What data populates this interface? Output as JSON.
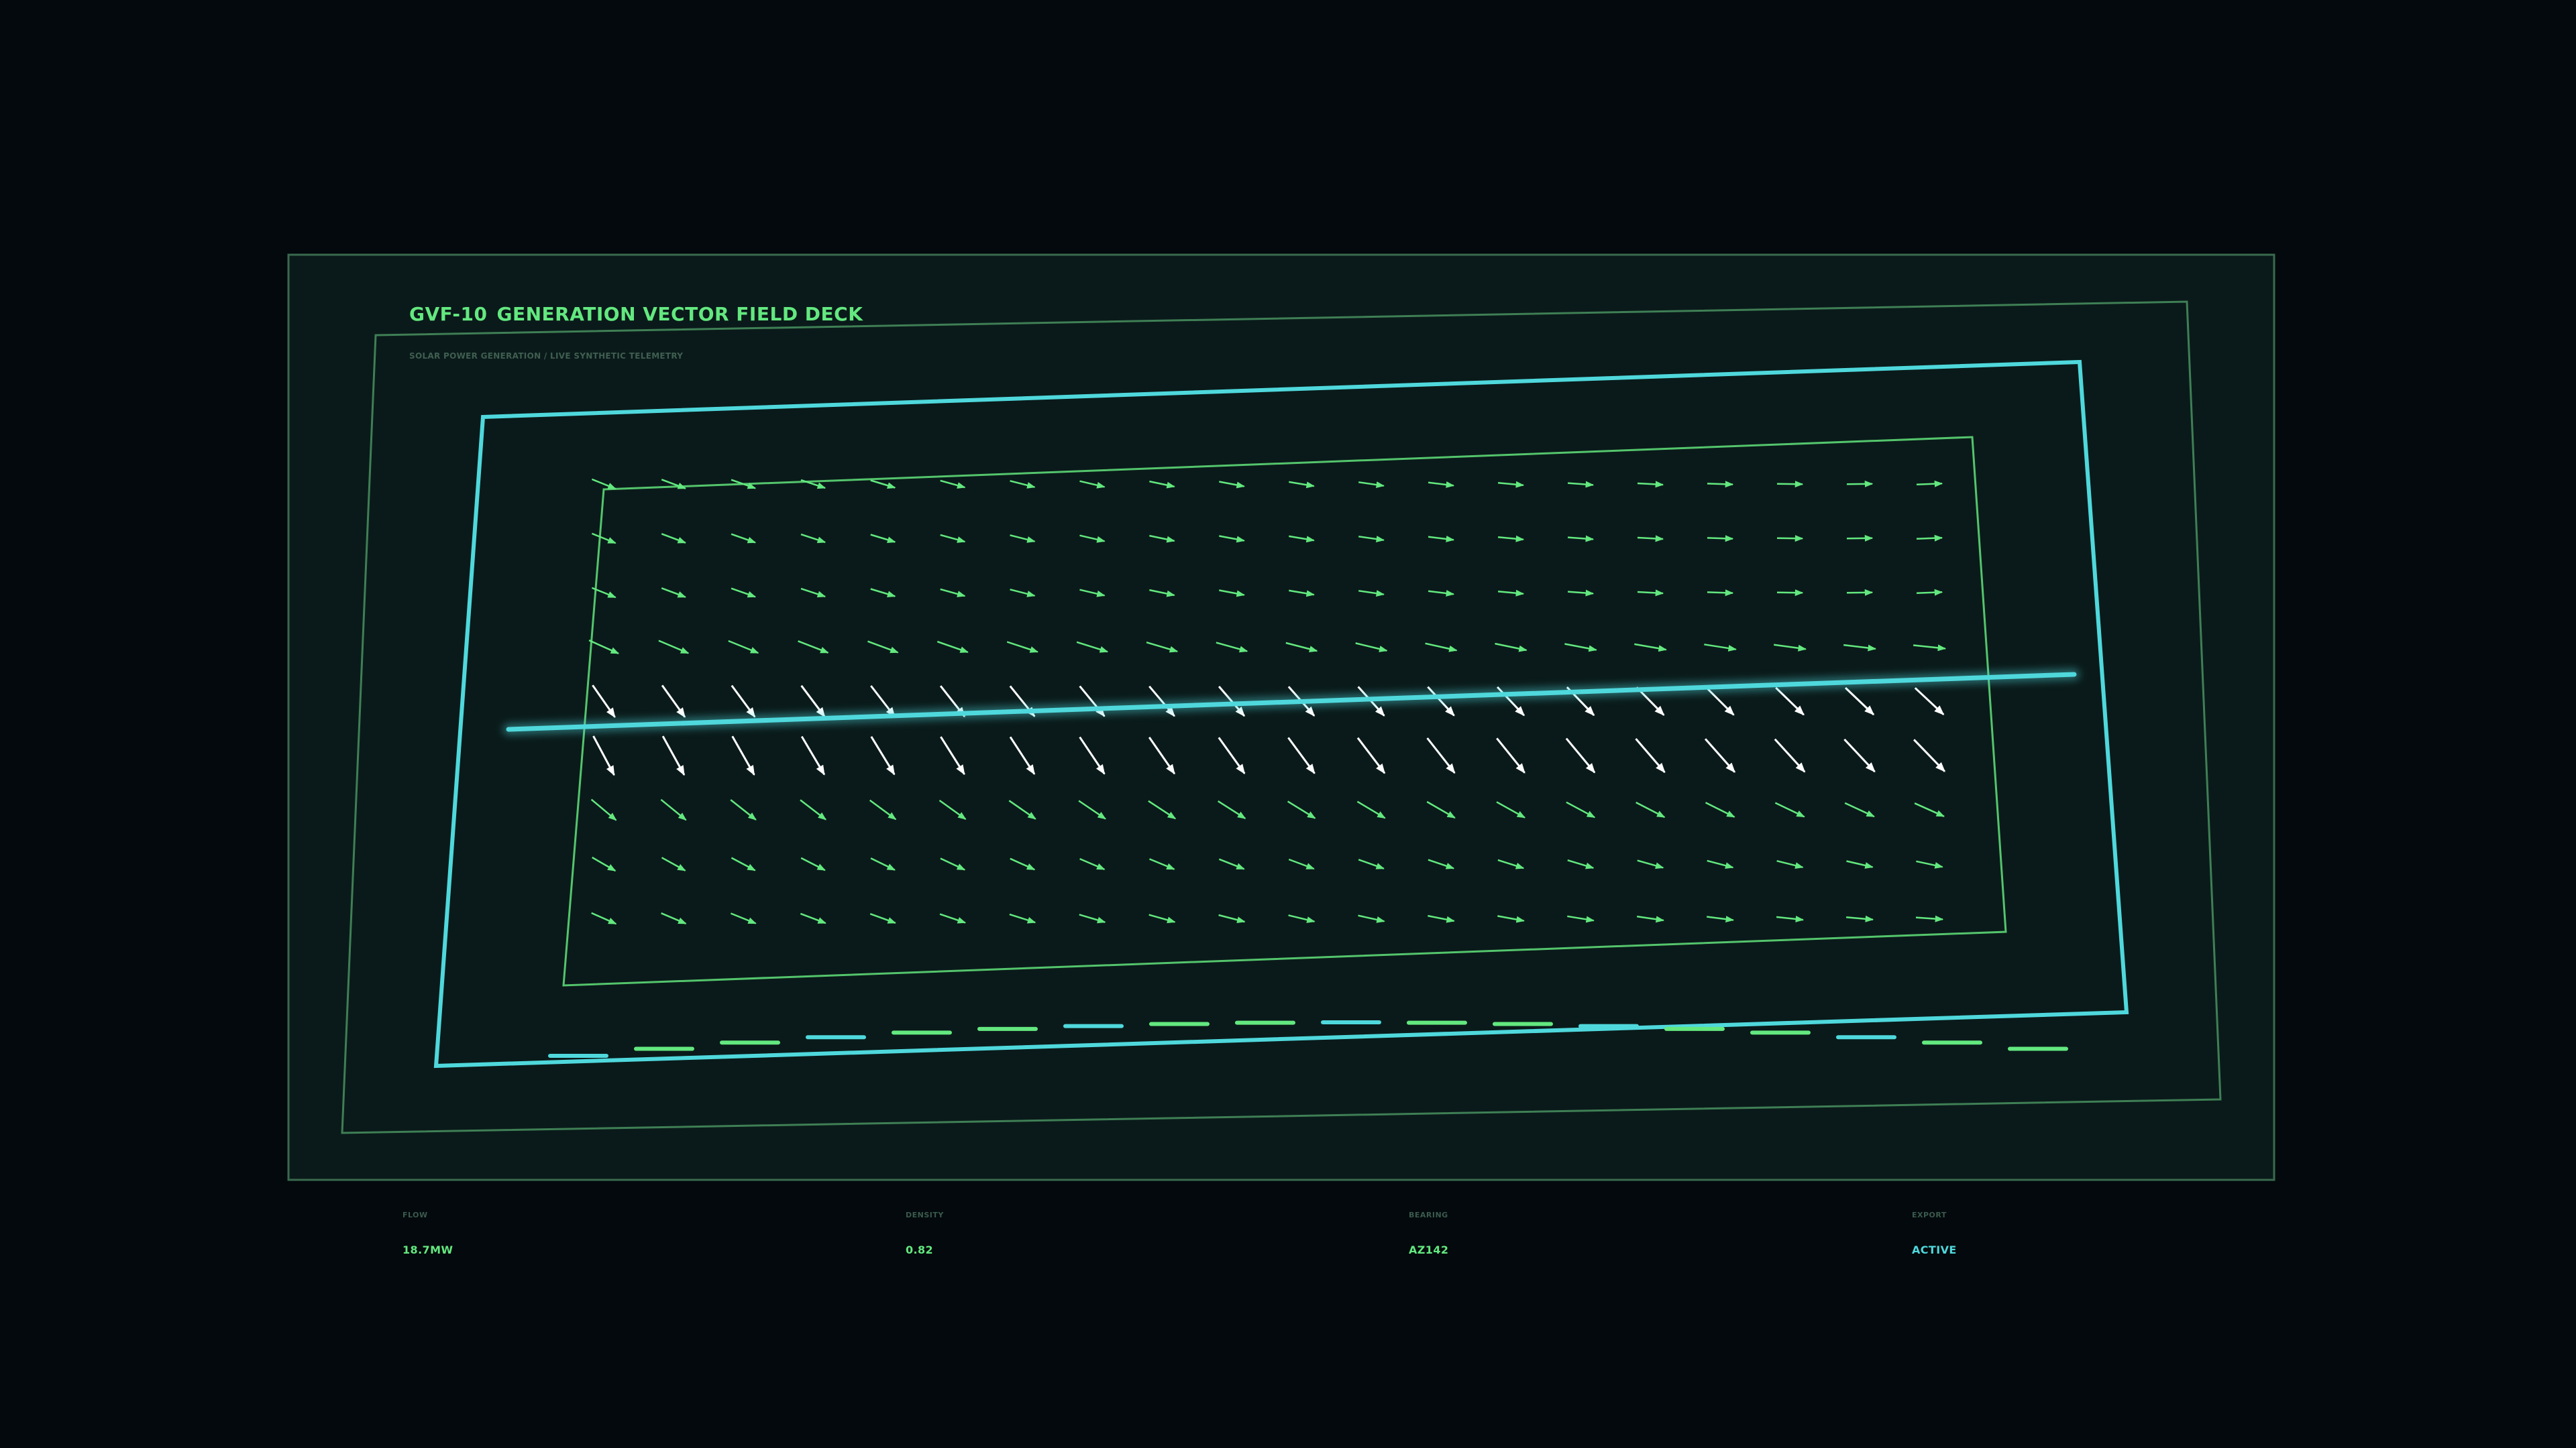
{
  "header": {
    "code": "GVF-10",
    "title": "GENERATION VECTOR FIELD DECK",
    "subtitle": "SOLAR POWER GENERATION / LIVE SYNTHETIC TELEMETRY"
  },
  "metrics": {
    "flow": {
      "label": "FLOW",
      "value": "18.7MW"
    },
    "density": {
      "label": "DENSITY",
      "value": "0.82"
    },
    "bearing": {
      "label": "BEARING",
      "value": "AZ142"
    },
    "export": {
      "label": "EXPORT",
      "value": "ACTIVE"
    }
  },
  "colors": {
    "background": "#03090c",
    "panel": "#0a1a1a",
    "green": "#63e87f",
    "cyan": "#4fd8dc",
    "white": "#ffffff",
    "muted": "#3f5e50"
  },
  "field": {
    "rows": 9,
    "cols": 20,
    "highlight_rows": [
      4,
      5
    ]
  }
}
